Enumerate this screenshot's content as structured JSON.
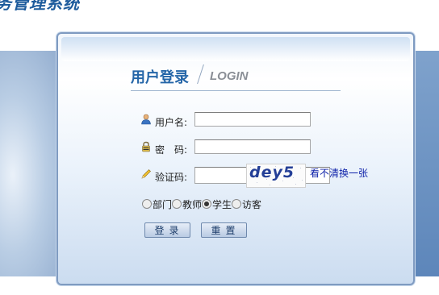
{
  "header": {
    "system_title": "务管理系统"
  },
  "login": {
    "title_cn": "用户登录",
    "title_en": "LOGIN",
    "username_label": "用户名:",
    "username_value": "",
    "password_label": "密　码:",
    "password_value": "",
    "captcha_label": "验证码:",
    "captcha_value": "",
    "captcha_image_text": "dey5",
    "refresh_text": "看不清换一张",
    "roles": [
      {
        "label": "部门",
        "selected": false
      },
      {
        "label": "教师",
        "selected": false
      },
      {
        "label": "学生",
        "selected": true
      },
      {
        "label": "访客",
        "selected": false
      }
    ],
    "login_button": "登录",
    "reset_button": "重置"
  },
  "icons": {
    "username": "user-icon",
    "password": "lock-icon",
    "captcha": "pencil-icon"
  },
  "colors": {
    "title_blue": "#2566a8",
    "link_blue": "#0b1fa8",
    "panel_border": "#7f9bc1"
  }
}
